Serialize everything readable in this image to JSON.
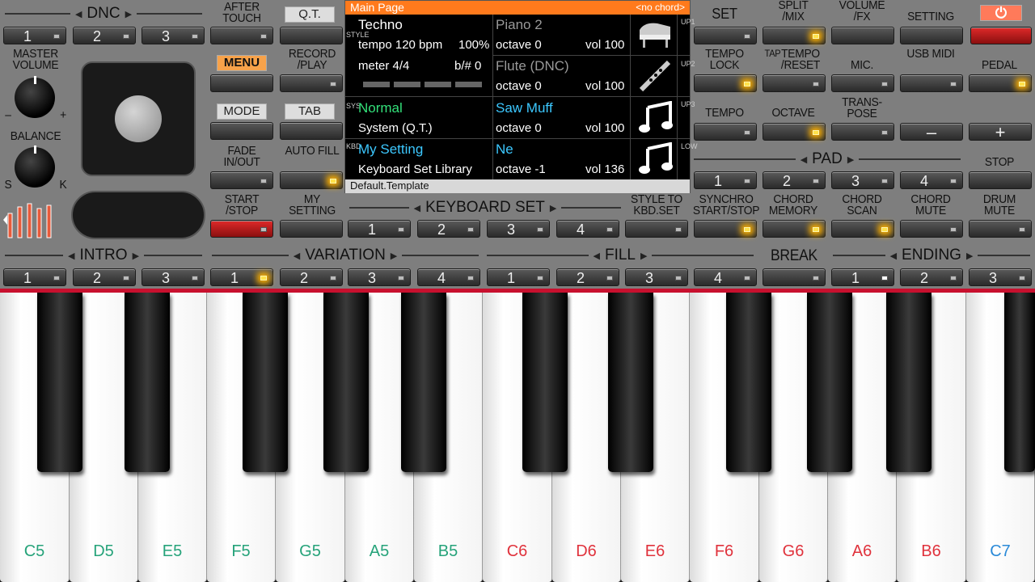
{
  "colors": {
    "accent": "#ff7a1c",
    "led_on": "#ffe24a",
    "cyan": "#3cc8ff",
    "green": "#33e07a",
    "note_red": "#e0323c",
    "note_green": "#26a37a",
    "note_blue": "#2a8ad8"
  },
  "dnc": {
    "title": "DNC",
    "buttons": [
      "1",
      "2",
      "3"
    ]
  },
  "after_touch": "AFTER TOUCH",
  "qt": "Q.T.",
  "menu": "MENU",
  "record_play": "RECORD /PLAY",
  "mode": "MODE",
  "tab": "TAB",
  "fade": "FADE IN/OUT",
  "auto_fill": "AUTO FILL",
  "start_stop": "START /STOP",
  "my_setting_btn": "MY SETTING",
  "master_volume": "MASTER VOLUME",
  "balance": "BALANCE",
  "balance_s": "S",
  "balance_k": "K",
  "vol_minus": "–",
  "vol_plus": "+",
  "screen": {
    "title": "Main Page",
    "chord": "<no chord>",
    "style_name": "Techno",
    "tempo": "tempo 120 bpm",
    "tempo_pct": "100%",
    "meter": "meter 4/4",
    "bsharp": "b/# 0",
    "up1_name": "Piano 2",
    "up1_oct": "octave 0",
    "up1_vol": "vol 100",
    "up2_name": "Flute (DNC)",
    "up2_oct": "octave 0",
    "up2_vol": "vol 100",
    "sys_name": "Normal",
    "sys_sub": "System (Q.T.)",
    "up3_name": "Saw Muff",
    "up3_oct": "octave 0",
    "up3_vol": "vol 100",
    "kbd_name": "My Setting",
    "kbd_sub": "Keyboard Set Library",
    "low_name": "Ne",
    "low_oct": "octave -1",
    "low_vol": "vol 136",
    "footer": "Default.Template",
    "side_style": "STYLE",
    "side_sys": "SYS",
    "side_kbd": "KBD",
    "side_up1": "UP1",
    "side_up2": "UP2",
    "side_up3": "UP3",
    "side_low": "LOW"
  },
  "set": "SET",
  "split_mix": "SPLIT /MIX",
  "volume_fx": "VOLUME /FX",
  "setting": "SETTING",
  "tempo_lock": "TEMPO LOCK",
  "tap": "TAP",
  "tempo_reset": "TEMPO /RESET",
  "mic": "MIC.",
  "usb_midi": "USB MIDI",
  "pedal": "PEDAL",
  "tempo": "TEMPO",
  "octave": "OCTAVE",
  "transpose": "TRANS- POSE",
  "minus": "–",
  "plus": "+",
  "pad": {
    "title": "PAD",
    "buttons": [
      "1",
      "2",
      "3",
      "4"
    ]
  },
  "stop": "STOP",
  "keyboard_set": {
    "title": "KEYBOARD SET",
    "buttons": [
      "1",
      "2",
      "3",
      "4"
    ]
  },
  "style_to_kbd": "STYLE TO KBD.SET",
  "synchro": "SYNCHRO START/STOP",
  "chord_memory": "CHORD MEMORY",
  "chord_scan": "CHORD SCAN",
  "chord_mute": "CHORD MUTE",
  "drum_mute": "DRUM MUTE",
  "intro": {
    "title": "INTRO",
    "buttons": [
      "1",
      "2",
      "3"
    ]
  },
  "variation": {
    "title": "VARIATION",
    "buttons": [
      "1",
      "2",
      "3",
      "4"
    ]
  },
  "fill": {
    "title": "FILL",
    "buttons": [
      "1",
      "2",
      "3",
      "4"
    ]
  },
  "break": "BREAK",
  "ending": {
    "title": "ENDING",
    "buttons": [
      "1",
      "2",
      "3"
    ]
  },
  "notes": [
    "C5",
    "D5",
    "E5",
    "F5",
    "G5",
    "A5",
    "B5",
    "C6",
    "D6",
    "E6",
    "F6",
    "G6",
    "A6",
    "B6",
    "C7"
  ]
}
